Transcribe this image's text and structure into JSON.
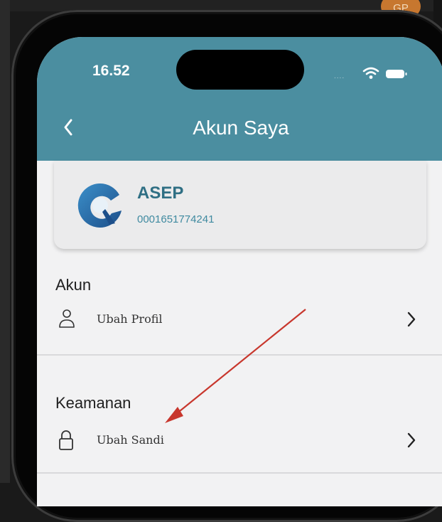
{
  "status_bar": {
    "time": "16.52",
    "dots": "....",
    "wifi_icon": "wifi-icon",
    "battery_icon": "battery-icon"
  },
  "background": {
    "corner_badge": "GP"
  },
  "header": {
    "title": "Akun Saya",
    "back_icon": "chevron-left-icon",
    "color": "#4b8ea0"
  },
  "profile": {
    "name": "ASEP",
    "account_number": "0001651774241",
    "logo_icon": "app-logo-icon",
    "name_color": "#2f6f84"
  },
  "sections": [
    {
      "title": "Akun",
      "items": [
        {
          "label": "Ubah Profil",
          "icon": "user-icon"
        }
      ]
    },
    {
      "title": "Keamanan",
      "items": [
        {
          "label": "Ubah Sandi",
          "icon": "lock-icon"
        }
      ]
    }
  ],
  "annotation": {
    "type": "arrow",
    "color": "#c8372d",
    "points_to": "Ubah Sandi"
  }
}
